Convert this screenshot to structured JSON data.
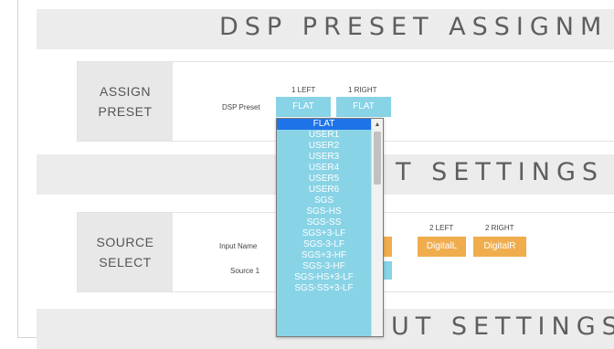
{
  "sections": {
    "dsp_title": "DSP PRESET ASSIGNM",
    "input_title_visible": "T SETTINGS",
    "output_title_visible": "UT SETTINGS"
  },
  "assign_preset": {
    "label_line1": "ASSIGN",
    "label_line2": "PRESET",
    "row_label": "DSP Preset",
    "col1": "1 LEFT",
    "col2": "1 RIGHT",
    "btn1": "FLAT",
    "btn2": "FLAT"
  },
  "source_select": {
    "label_line1": "SOURCE",
    "label_line2": "SELECT",
    "input_name_label": "Input Name",
    "source_label": "Source 1",
    "col3": "2 LEFT",
    "col4": "2 RIGHT",
    "btn3": "DigitalL",
    "btn4": "DigitalR"
  },
  "dropdown": {
    "selected": "FLAT",
    "options": [
      "FLAT",
      "USER1",
      "USER2",
      "USER3",
      "USER4",
      "USER5",
      "USER6",
      "SGS",
      "SGS-HS",
      "SGS-SS",
      "SGS+3-LF",
      "SGS-3-LF",
      "SGS+3-HF",
      "SGS-3-HF",
      "SGS-HS+3-LF",
      "SGS-SS+3-LF"
    ]
  },
  "colors": {
    "preset_button": "#88d3e6",
    "selected_option": "#1e73e8",
    "source_button": "#f0ad4e",
    "band": "#ececec"
  }
}
